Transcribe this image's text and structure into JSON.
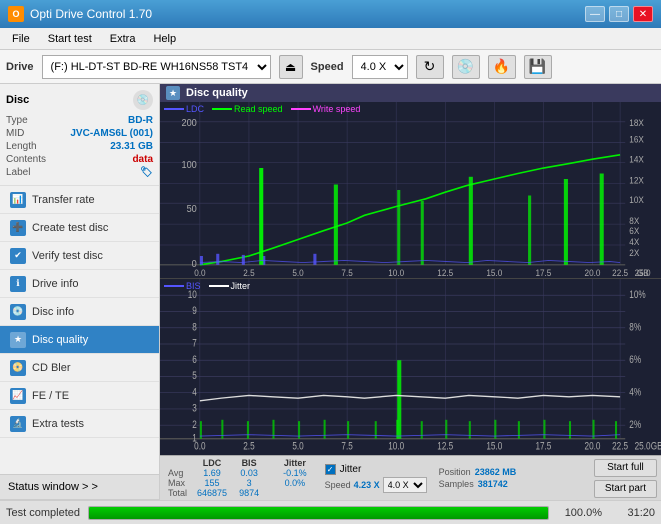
{
  "titleBar": {
    "title": "Opti Drive Control 1.70",
    "minBtn": "—",
    "maxBtn": "□",
    "closeBtn": "✕"
  },
  "menuBar": {
    "items": [
      "File",
      "Start test",
      "Extra",
      "Help"
    ]
  },
  "driveBar": {
    "label": "Drive",
    "driveValue": "(F:)  HL-DT-ST BD-RE  WH16NS58 TST4",
    "speedLabel": "Speed",
    "speedValue": "4.0 X"
  },
  "disc": {
    "title": "Disc",
    "type_label": "Type",
    "type_value": "BD-R",
    "mid_label": "MID",
    "mid_value": "JVC-AMS6L (001)",
    "length_label": "Length",
    "length_value": "23.31 GB",
    "contents_label": "Contents",
    "contents_value": "data",
    "label_label": "Label",
    "label_value": ""
  },
  "navItems": [
    {
      "id": "transfer-rate",
      "label": "Transfer rate",
      "active": false
    },
    {
      "id": "create-test-disc",
      "label": "Create test disc",
      "active": false
    },
    {
      "id": "verify-test-disc",
      "label": "Verify test disc",
      "active": false
    },
    {
      "id": "drive-info",
      "label": "Drive info",
      "active": false
    },
    {
      "id": "disc-info",
      "label": "Disc info",
      "active": false
    },
    {
      "id": "disc-quality",
      "label": "Disc quality",
      "active": true
    },
    {
      "id": "cd-bler",
      "label": "CD Bler",
      "active": false
    },
    {
      "id": "fe-te",
      "label": "FE / TE",
      "active": false
    },
    {
      "id": "extra-tests",
      "label": "Extra tests",
      "active": false
    }
  ],
  "statusWindow": {
    "label": "Status window > >"
  },
  "progress": {
    "label": "Test completed",
    "percent": 100,
    "displayPercent": "100.0%",
    "timeValue": "31:20"
  },
  "chartArea": {
    "title": "Disc quality",
    "topChart": {
      "legends": [
        {
          "label": "LDC",
          "color": "#0000ff"
        },
        {
          "label": "Read speed",
          "color": "#00ff00"
        },
        {
          "label": "Write speed",
          "color": "#ff00ff"
        }
      ],
      "yMax": 200,
      "yAxisRight": [
        "18X",
        "16X",
        "14X",
        "12X",
        "10X",
        "8X",
        "6X",
        "4X",
        "2X"
      ],
      "xMax": 25
    },
    "bottomChart": {
      "legends": [
        {
          "label": "BIS",
          "color": "#0000ff"
        },
        {
          "label": "Jitter",
          "color": "#ffffff"
        }
      ],
      "yMax": 10,
      "yAxisRight": [
        "10%",
        "8%",
        "6%",
        "4%",
        "2%"
      ],
      "xMax": 25
    }
  },
  "stats": {
    "columns": [
      "LDC",
      "BIS",
      "",
      "Jitter",
      "Speed",
      "4.23 X",
      "",
      "4.0 X"
    ],
    "rows": [
      {
        "label": "Avg",
        "ldc": "1.69",
        "bis": "0.03",
        "jitter": "-0.1%"
      },
      {
        "label": "Max",
        "ldc": "155",
        "bis": "3",
        "jitter": "0.0%"
      },
      {
        "label": "Total",
        "ldc": "646875",
        "bis": "9874",
        "jitter": ""
      }
    ],
    "position": {
      "label": "Position",
      "value": "23862 MB"
    },
    "samples": {
      "label": "Samples",
      "value": "381742"
    },
    "speedLabel": "Speed",
    "speedValue": "4.23 X",
    "speedSelectValue": "4.0 X",
    "jitterLabel": "Jitter",
    "jitterChecked": true,
    "startFullLabel": "Start full",
    "startPartLabel": "Start part"
  }
}
